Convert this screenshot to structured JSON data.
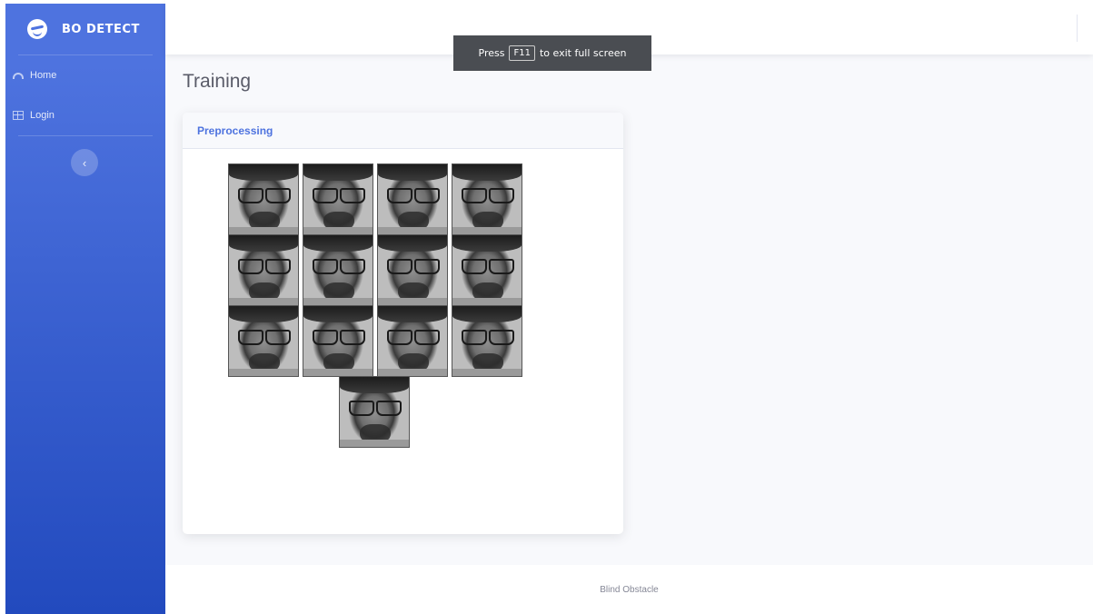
{
  "brand": {
    "name": "BO DETECT"
  },
  "sidebar": {
    "items": [
      {
        "label": "Home",
        "icon": "dashboard-icon"
      },
      {
        "label": "Login",
        "icon": "table-icon"
      }
    ],
    "toggle_icon": "chevron-left-icon"
  },
  "fullscreen_notice": {
    "before": "Press",
    "key": "F11",
    "after": "to exit full screen"
  },
  "page": {
    "title": "Training"
  },
  "card": {
    "title": "Preprocessing",
    "face_count": 13
  },
  "footer": {
    "text": "Blind Obstacle"
  },
  "colors": {
    "primary": "#4e73df",
    "sidebar_bottom": "#224abe",
    "background": "#f8f9fc"
  }
}
